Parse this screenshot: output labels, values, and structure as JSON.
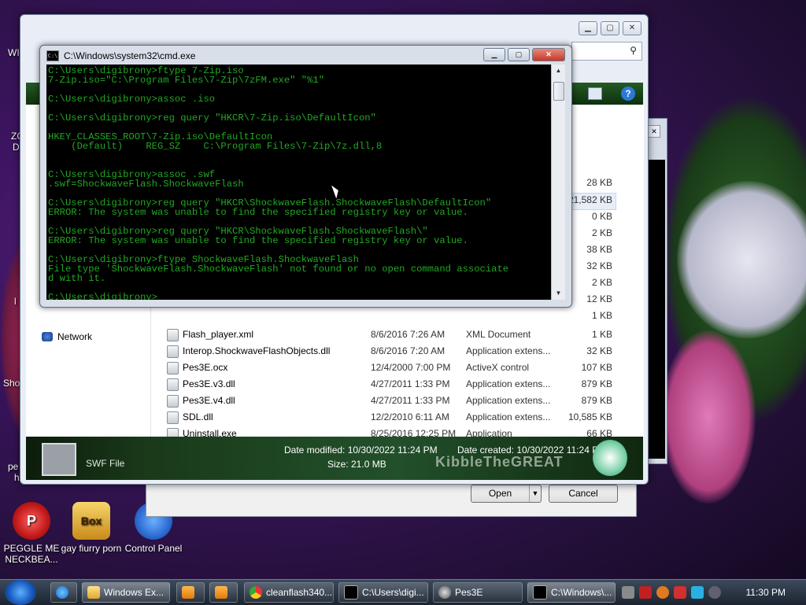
{
  "desktop": {
    "icons": [
      {
        "label": "PEGGLE ME NECKBEA...",
        "glyph": "P"
      },
      {
        "label": "gay fiurry porn",
        "glyph": "Box"
      },
      {
        "label": "Control Panel",
        "glyph": ""
      }
    ],
    "peek_labels": [
      "WI",
      "ZC",
      "D",
      "Sho",
      "pe",
      "h",
      "l"
    ]
  },
  "explorer": {
    "nav_network": "Network",
    "sizes_top": [
      "28 KB",
      "21,582 KB",
      "0 KB",
      "2 KB",
      "38 KB",
      "32 KB",
      "2 KB",
      "12 KB",
      "1 KB"
    ],
    "files": [
      {
        "name": "Flash_player.xml",
        "date": "8/6/2016 7:26 AM",
        "type": "XML Document",
        "size": "1 KB"
      },
      {
        "name": "Interop.ShockwaveFlashObjects.dll",
        "date": "8/6/2016 7:20 AM",
        "type": "Application extens...",
        "size": "32 KB"
      },
      {
        "name": "Pes3E.ocx",
        "date": "12/4/2000 7:00 PM",
        "type": "ActiveX control",
        "size": "107 KB"
      },
      {
        "name": "Pes3E.v3.dll",
        "date": "4/27/2011 1:33 PM",
        "type": "Application extens...",
        "size": "879 KB"
      },
      {
        "name": "Pes3E.v4.dll",
        "date": "4/27/2011 1:33 PM",
        "type": "Application extens...",
        "size": "879 KB"
      },
      {
        "name": "SDL.dll",
        "date": "12/2/2010 6:11 AM",
        "type": "Application extens...",
        "size": "10,585 KB"
      },
      {
        "name": "Uninstall.exe",
        "date": "8/25/2016 12:25 PM",
        "type": "Application",
        "size": "66 KB"
      }
    ],
    "details": {
      "kind": "SWF File",
      "modified": "Date modified: 10/30/2022 11:24 PM",
      "size": "Size: 21.0 MB",
      "created": "Date created: 10/30/2022 11:24 PM",
      "watermark": "KibbleTheGREAT"
    }
  },
  "dialog": {
    "open_label": "Open",
    "cancel_label": "Cancel"
  },
  "cmd": {
    "title": "C:\\Windows\\system32\\cmd.exe",
    "lines": [
      "C:\\Users\\digibrony>ftype 7-Zip.iso",
      "7-Zip.iso=\"C:\\Program Files\\7-Zip\\7zFM.exe\" \"%1\"",
      "",
      "C:\\Users\\digibrony>assoc .iso",
      "",
      "C:\\Users\\digibrony>reg query \"HKCR\\7-Zip.iso\\DefaultIcon\"",
      "",
      "HKEY_CLASSES_ROOT\\7-Zip.iso\\DefaultIcon",
      "    (Default)    REG_SZ    C:\\Program Files\\7-Zip\\7z.dll,8",
      "",
      "",
      "C:\\Users\\digibrony>assoc .swf",
      ".swf=ShockwaveFlash.ShockwaveFlash",
      "",
      "C:\\Users\\digibrony>reg query \"HKCR\\ShockwaveFlash.ShockwaveFlash\\DefaultIcon\"",
      "ERROR: The system was unable to find the specified registry key or value.",
      "",
      "C:\\Users\\digibrony>reg query \"HKCR\\ShockwaveFlash.ShockwaveFlash\\\"",
      "ERROR: The system was unable to find the specified registry key or value.",
      "",
      "C:\\Users\\digibrony>ftype ShockwaveFlash.ShockwaveFlash",
      "File type 'ShockwaveFlash.ShockwaveFlash' not found or no open command associate",
      "d with it.",
      "",
      "C:\\Users\\digibrony>_"
    ]
  },
  "taskbar": {
    "items": [
      {
        "label": "",
        "icon": "ie-icon"
      },
      {
        "label": "Windows Ex...",
        "icon": "folder-icon"
      },
      {
        "label": "",
        "icon": "media-icon"
      },
      {
        "label": "",
        "icon": "paint-icon"
      },
      {
        "label": "cleanflash340...",
        "icon": "chrome-icon"
      },
      {
        "label": "C:\\Users\\digi...",
        "icon": "7zip-icon"
      },
      {
        "label": "Pes3E",
        "icon": "pes-icon"
      },
      {
        "label": "C:\\Windows\\...",
        "icon": "cmd-icon"
      }
    ],
    "clock": "11:30 PM"
  }
}
